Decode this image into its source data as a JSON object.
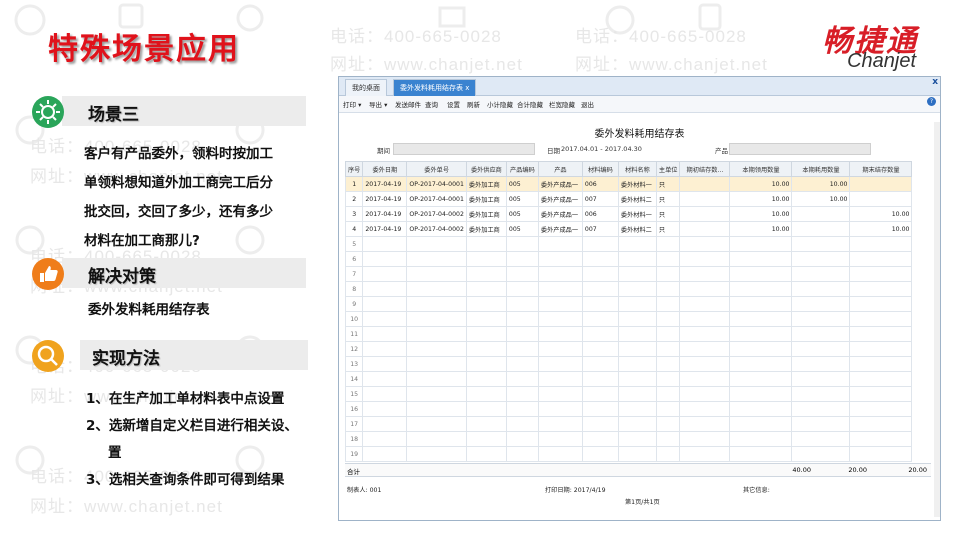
{
  "slide": {
    "title": "特殊场景应用",
    "watermark_lines": [
      "电话：400-665-0028",
      "网址：www.chanjet.net"
    ],
    "sections": [
      {
        "title": "场景三",
        "icon": "sun-icon",
        "color": "#2aa55a"
      },
      {
        "title": "解决对策",
        "icon": "thumbs-up-icon",
        "color": "#ef7d1a"
      },
      {
        "title": "实现方法",
        "icon": "magnifier-icon",
        "color": "#f0a31e"
      }
    ],
    "scene_text": [
      "客户有产品委外，领料时按加工",
      "单领料想知道外加工商完工后分",
      "批交回，交回了多少，还有多少",
      "材料在加工商那儿?"
    ],
    "solution_text": "委外发料耗用结存表",
    "steps": [
      "1、在生产加工单材料表中点设置",
      "2、选新增自定义栏目进行相关设、",
      "置",
      "3、选相关查询条件即可得到结果"
    ]
  },
  "logo": {
    "cn": "畅捷通",
    "en": "Chanjet",
    "brand_color": "#d81e27"
  },
  "window": {
    "close": "x",
    "help": "?",
    "tabs": [
      {
        "label": "我的桌面"
      },
      {
        "label": "委外发料耗用结存表",
        "close": "x"
      }
    ],
    "toolbar": [
      "打印 ▾",
      "导出 ▾",
      "发送邮件",
      "查询",
      "设置",
      "刷新",
      "小计隐藏",
      "合计隐藏",
      "栏宽隐藏",
      "退出"
    ],
    "report_title": "委外发料耗用结存表",
    "filters": {
      "period_label": "期间",
      "date_label": "日期",
      "date_value": "2017.04.01 - 2017.04.30",
      "product_label": "产品"
    },
    "columns": [
      "序号",
      "委外日期",
      "委外单号",
      "委外供应商",
      "产品编码",
      "产品",
      "材料编码",
      "材料名称",
      "主单位",
      "期初结存数...",
      "本期领用数量",
      "本期耗用数量",
      "期末结存数量"
    ],
    "rows": [
      [
        "1",
        "2017-04-19",
        "OP-2017-04-0001",
        "委外加工商",
        "005",
        "委外产成品一",
        "006",
        "委外材料一",
        "只",
        "",
        "10.00",
        "10.00",
        ""
      ],
      [
        "2",
        "2017-04-19",
        "OP-2017-04-0001",
        "委外加工商",
        "005",
        "委外产成品一",
        "007",
        "委外材料二",
        "只",
        "",
        "10.00",
        "10.00",
        ""
      ],
      [
        "3",
        "2017-04-19",
        "OP-2017-04-0002",
        "委外加工商",
        "005",
        "委外产成品一",
        "006",
        "委外材料一",
        "只",
        "",
        "10.00",
        "",
        "10.00"
      ],
      [
        "4",
        "2017-04-19",
        "OP-2017-04-0002",
        "委外加工商",
        "005",
        "委外产成品一",
        "007",
        "委外材料二",
        "只",
        "",
        "10.00",
        "",
        "10.00"
      ]
    ],
    "empty_row_numbers": [
      "5",
      "6",
      "7",
      "8",
      "9",
      "10",
      "11",
      "12",
      "13",
      "14",
      "15",
      "16",
      "17",
      "18",
      "19"
    ],
    "totals": {
      "label": "合计",
      "received": "40.00",
      "consumed": "20.00",
      "ending": "20.00"
    },
    "footer": {
      "maker": "制表人: 001",
      "print_date": "打印日期: 2017/4/19",
      "other": "其它信息:",
      "page": "第1页/共1页"
    }
  }
}
